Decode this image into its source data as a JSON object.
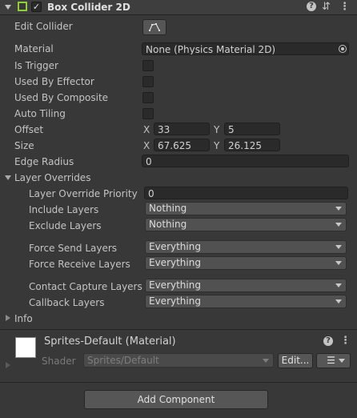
{
  "component": {
    "title": "Box Collider 2D",
    "enabled": true,
    "icons": [
      "help-icon",
      "preset-icon",
      "context-menu-icon"
    ]
  },
  "fields": {
    "edit_collider": "Edit Collider",
    "material_label": "Material",
    "material_value": "None (Physics Material 2D)",
    "is_trigger": "Is Trigger",
    "used_by_effector": "Used By Effector",
    "used_by_composite": "Used By Composite",
    "auto_tiling": "Auto Tiling",
    "offset_label": "Offset",
    "offset_x": "33",
    "offset_y": "5",
    "size_label": "Size",
    "size_x": "67.625",
    "size_y": "26.125",
    "edge_radius_label": "Edge Radius",
    "edge_radius_value": "0",
    "x_axis": "X",
    "y_axis": "Y"
  },
  "layer_overrides": {
    "label": "Layer Overrides",
    "priority_label": "Layer Override Priority",
    "priority_value": "0",
    "include_label": "Include Layers",
    "include_value": "Nothing",
    "exclude_label": "Exclude Layers",
    "exclude_value": "Nothing",
    "force_send_label": "Force Send Layers",
    "force_send_value": "Everything",
    "force_receive_label": "Force Receive Layers",
    "force_receive_value": "Everything",
    "contact_capture_label": "Contact Capture Layers",
    "contact_capture_value": "Everything",
    "callback_label": "Callback Layers",
    "callback_value": "Everything"
  },
  "info_label": "Info",
  "material_panel": {
    "title": "Sprites-Default (Material)",
    "shader_label": "Shader",
    "shader_value": "Sprites/Default",
    "edit_button": "Edit...",
    "list_icon": "list-icon"
  },
  "add_component": "Add Component",
  "colors": {
    "background": "#383838",
    "header": "#3e3e3e",
    "field": "#2a2a2a",
    "dropdown": "#515151",
    "accent_green": "#8fcf3a"
  }
}
